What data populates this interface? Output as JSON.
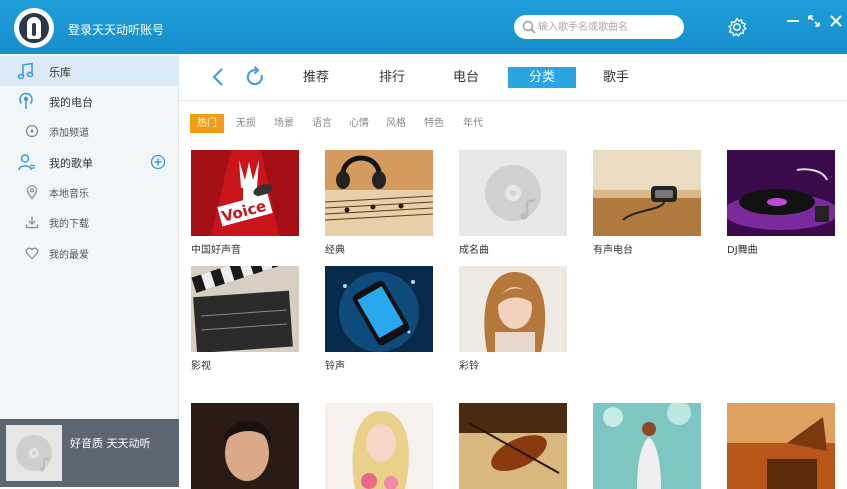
{
  "titlebar": {
    "login_text": "登录天天动听账号",
    "search_placeholder": "输入歌手名或歌曲名"
  },
  "sidebar": {
    "items": [
      {
        "label": "乐库",
        "icon": "music-note-icon"
      },
      {
        "label": "我的电台",
        "icon": "radio-icon"
      },
      {
        "label": "添加频道",
        "icon": "add-channel-icon"
      },
      {
        "label": "我的歌单",
        "icon": "user-icon"
      },
      {
        "label": "本地音乐",
        "icon": "location-pin-icon"
      },
      {
        "label": "我的下载",
        "icon": "download-icon"
      },
      {
        "label": "我的最爱",
        "icon": "heart-icon"
      }
    ],
    "now_playing": "好音质 天天动听"
  },
  "nav": {
    "tabs": [
      {
        "label": "推荐"
      },
      {
        "label": "排行"
      },
      {
        "label": "电台"
      },
      {
        "label": "分类",
        "active": true
      },
      {
        "label": "歌手"
      }
    ]
  },
  "filters": [
    {
      "label": "热门",
      "active": true
    },
    {
      "label": "无损"
    },
    {
      "label": "场景"
    },
    {
      "label": "语言"
    },
    {
      "label": "心情"
    },
    {
      "label": "风格"
    },
    {
      "label": "特色"
    },
    {
      "label": "年代"
    }
  ],
  "cards": [
    {
      "label": "中国好声音",
      "thumb": "voice-china-logo"
    },
    {
      "label": "经典",
      "thumb": "sheet-music-headphones"
    },
    {
      "label": "成名曲",
      "thumb": "placeholder-disc"
    },
    {
      "label": "有声电台",
      "thumb": "vintage-microphone"
    },
    {
      "label": "DJ舞曲",
      "thumb": "turntable"
    },
    {
      "label": "影视",
      "thumb": "clapperboard"
    },
    {
      "label": "铃声",
      "thumb": "mobile-phone"
    },
    {
      "label": "彩铃",
      "thumb": "woman-portrait"
    },
    {
      "label": "",
      "thumb": "male-singer-portrait"
    },
    {
      "label": "",
      "thumb": "blonde-singer"
    },
    {
      "label": "",
      "thumb": "violin-sheet"
    },
    {
      "label": "",
      "thumb": "girl-forest"
    },
    {
      "label": "",
      "thumb": "gramophone"
    }
  ],
  "colors": {
    "titlebar": "#1a96d3",
    "accent": "#2aa5e2",
    "filter_active": "#f59c17",
    "sidebar_bg": "#f3f6f8",
    "nowplaying_bg": "#5b6670"
  }
}
